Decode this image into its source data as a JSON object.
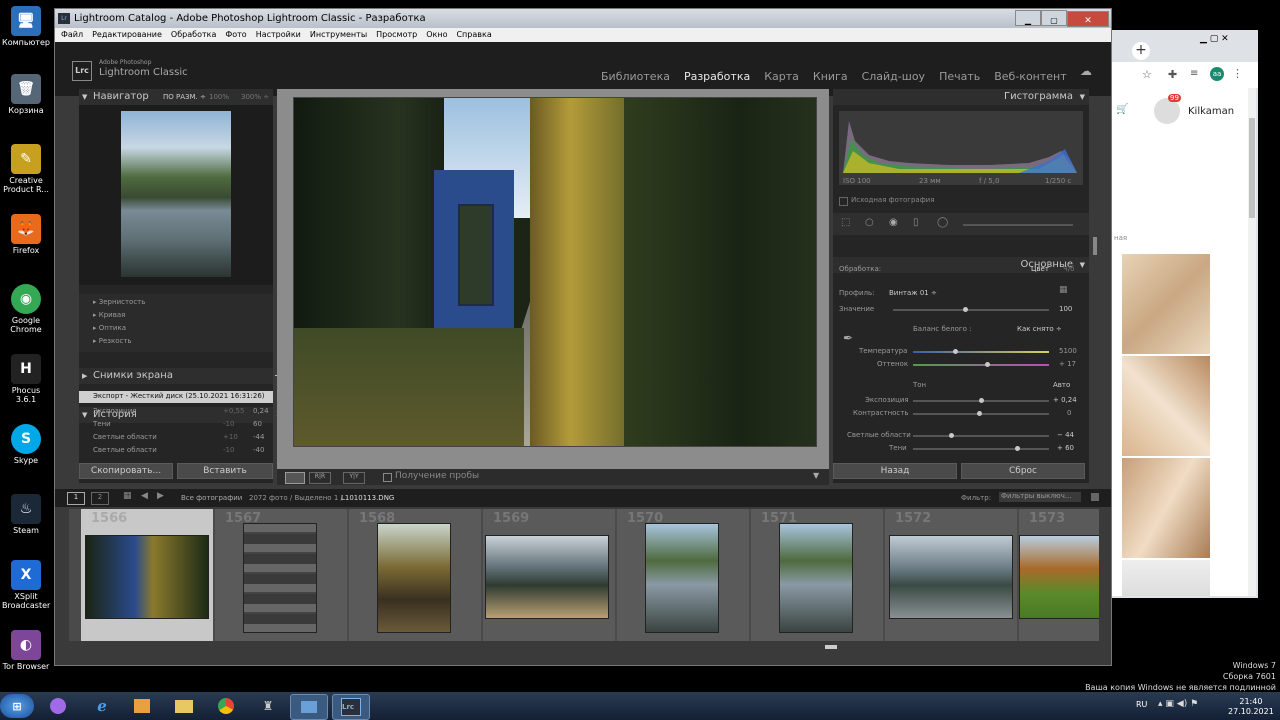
{
  "desktop": {
    "icons": [
      {
        "label": "Компьютер",
        "glyph": "🖥",
        "color": "#2a6fb8"
      },
      {
        "label": "Корзина",
        "glyph": "🗑",
        "color": "#556677"
      },
      {
        "label": "Creative Product R...",
        "glyph": "✎",
        "color": "#c8a020"
      },
      {
        "label": "Firefox",
        "glyph": "🦊",
        "color": "#e86a1c"
      },
      {
        "label": "Google Chrome",
        "glyph": "◉",
        "color": "#34a853"
      },
      {
        "label": "Phocus 3.6.1",
        "glyph": "H",
        "color": "#222"
      },
      {
        "label": "Skype",
        "glyph": "S",
        "color": "#00a8e8"
      },
      {
        "label": "Steam",
        "glyph": "♨",
        "color": "#1b2838"
      },
      {
        "label": "XSplit Broadcaster",
        "glyph": "X",
        "color": "#1e6bd6"
      },
      {
        "label": "Tor Browser",
        "glyph": "◐",
        "color": "#7d4698"
      }
    ],
    "watermark": {
      "line1": "Windows 7",
      "line2": "Сборка 7601",
      "line3": "Ваша копия Windows не является подлинной"
    }
  },
  "window": {
    "title": "Lightroom Catalog - Adobe Photoshop Lightroom Classic - Разработка",
    "menu": [
      "Файл",
      "Редактирование",
      "Обработка",
      "Фото",
      "Настройки",
      "Инструменты",
      "Просмотр",
      "Окно",
      "Справка"
    ]
  },
  "header": {
    "logo_badge": "Lrc",
    "logo_line1": "Adobe Photoshop",
    "logo_line2": "Lightroom Classic",
    "modules": [
      "Библиотека",
      "Разработка",
      "Карта",
      "Книга",
      "Слайд-шоу",
      "Печать",
      "Веб-контент"
    ],
    "active_module": "Разработка"
  },
  "left": {
    "navigator": {
      "title": "Навигатор",
      "opt1": "ПО РАЗМ. ÷",
      "opt2": "100%",
      "opt3": "300% ÷"
    },
    "preset_items": [
      "Зернистость",
      "Кривая",
      "Оптика",
      "Резкость"
    ],
    "snapshots_title": "Снимки экрана",
    "history": {
      "title": "История",
      "items": [
        {
          "label": "Экспорт - Жесткий диск (25.10.2021 16:31:26)",
          "a": "",
          "b": ""
        },
        {
          "label": "Экспозиция",
          "a": "+0,55",
          "b": "0,24"
        },
        {
          "label": "Тени",
          "a": "-10",
          "b": "60"
        },
        {
          "label": "Светлые области",
          "a": "+10",
          "b": "-44"
        },
        {
          "label": "Светлые области",
          "a": "-10",
          "b": "-40"
        }
      ]
    },
    "copy_btn": "Скопировать...",
    "paste_btn": "Вставить"
  },
  "toolbar": {
    "proof_label": "Получение пробы"
  },
  "right": {
    "histogram": {
      "title": "Гистограмма",
      "info": [
        "ISO 100",
        "23 мм",
        "f / 5,0",
        "1/250 с"
      ],
      "original_label": "Исходная фотография"
    },
    "basic": {
      "title": "Основные",
      "treatment_label": "Обработка:",
      "treatment_value": "Цвет",
      "treatment_alt": "Ч/б",
      "profile_label": "Профиль:",
      "profile_value": "Винтаж 01 ÷",
      "amount_label": "Значение",
      "amount_value": "100",
      "wb_label": "Баланс белого :",
      "wb_value": "Как снято ÷",
      "temp_label": "Температура",
      "temp_value": "5100",
      "tint_label": "Оттенок",
      "tint_value": "+ 17",
      "tone_label": "Тон",
      "auto_label": "Авто",
      "exposure_label": "Экспозиция",
      "exposure_value": "+ 0,24",
      "contrast_label": "Контрастность",
      "contrast_value": "0",
      "highlights_label": "Светлые области",
      "highlights_value": "− 44",
      "shadows_label": "Тени",
      "shadows_value": "+ 60"
    },
    "prev_btn": "Назад",
    "reset_btn": "Сброс"
  },
  "filmstrip": {
    "page1": "1",
    "page2": "2",
    "source": "Все фотографии",
    "count": "2072 фото / Выделено 1 /",
    "filename": "L1010113.DNG",
    "filter_label": "Фильтр:",
    "filter_value": "Фильтры выключ...",
    "numbers": [
      "1566",
      "1567",
      "1568",
      "1569",
      "1570",
      "1571",
      "1572",
      "1573"
    ]
  },
  "chrome": {
    "user": "Kilkaman",
    "badge": "99",
    "avatar": "aa",
    "tag": "ная"
  },
  "taskbar": {
    "lang": "RU",
    "time": "21:40",
    "date": "27.10.2021"
  }
}
